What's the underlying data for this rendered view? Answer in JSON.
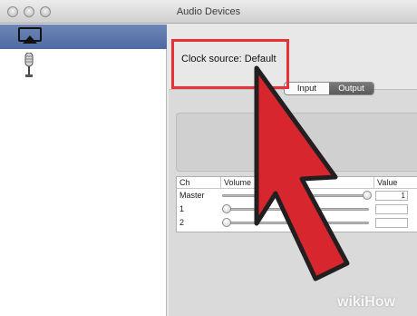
{
  "window": {
    "title": "Audio Devices"
  },
  "sidebar": {
    "devices": [
      {
        "icon": "airplay-icon",
        "selected": true
      },
      {
        "icon": "microphone-icon",
        "selected": false
      }
    ]
  },
  "clock": {
    "label": "Clock source:",
    "value": "Default"
  },
  "tabs": [
    {
      "label": "Input",
      "active": false
    },
    {
      "label": "Output",
      "active": true
    }
  ],
  "table": {
    "headers": {
      "ch": "Ch",
      "volume": "Volume",
      "value": "Value"
    },
    "rows": [
      {
        "ch": "Master",
        "level": 1.0,
        "value": "1"
      },
      {
        "ch": "1",
        "level": 0.0,
        "value": ""
      },
      {
        "ch": "2",
        "level": 0.0,
        "value": ""
      }
    ]
  },
  "annotation": {
    "highlight_color": "#e8323a",
    "arrow_color": "#d8262f"
  },
  "watermark": {
    "text": "wikiHow"
  }
}
